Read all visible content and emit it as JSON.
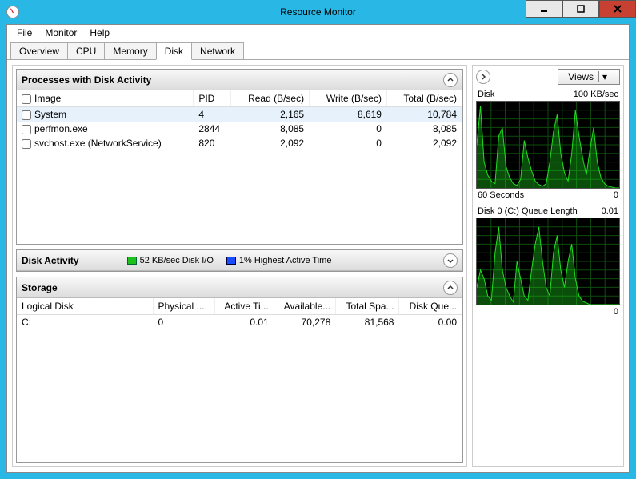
{
  "window": {
    "title": "Resource Monitor"
  },
  "menu": {
    "file": "File",
    "monitor": "Monitor",
    "help": "Help"
  },
  "tabs": {
    "overview": "Overview",
    "cpu": "CPU",
    "memory": "Memory",
    "disk": "Disk",
    "network": "Network",
    "active": "disk"
  },
  "panels": {
    "processes": {
      "title": "Processes with Disk Activity",
      "columns": {
        "image": "Image",
        "pid": "PID",
        "read": "Read (B/sec)",
        "write": "Write (B/sec)",
        "total": "Total (B/sec)"
      },
      "rows": [
        {
          "image": "System",
          "pid": "4",
          "read": "2,165",
          "write": "8,619",
          "total": "10,784",
          "selected": true
        },
        {
          "image": "perfmon.exe",
          "pid": "2844",
          "read": "8,085",
          "write": "0",
          "total": "8,085",
          "selected": false
        },
        {
          "image": "svchost.exe (NetworkService)",
          "pid": "820",
          "read": "2,092",
          "write": "0",
          "total": "2,092",
          "selected": false
        }
      ]
    },
    "diskActivity": {
      "title": "Disk Activity",
      "io_label": "52 KB/sec Disk I/O",
      "active_label": "1% Highest Active Time"
    },
    "storage": {
      "title": "Storage",
      "columns": {
        "logical": "Logical Disk",
        "physical": "Physical ...",
        "active": "Active Ti...",
        "available": "Available...",
        "total": "Total Spa...",
        "queue": "Disk Que..."
      },
      "rows": [
        {
          "logical": "C:",
          "physical": "0",
          "active": "0.01",
          "available": "70,278",
          "total": "81,568",
          "queue": "0.00"
        }
      ]
    }
  },
  "sidebar": {
    "views": "Views",
    "chart1": {
      "title": "Disk",
      "scale": "100 KB/sec",
      "xlabel": "60 Seconds",
      "xright": "0"
    },
    "chart2": {
      "title": "Disk 0 (C:) Queue Length",
      "scale": "0.01",
      "xright": "0"
    }
  },
  "chart_data": [
    {
      "type": "area",
      "title": "Disk",
      "xlabel": "60 Seconds",
      "ylabel": "KB/sec",
      "ylim": [
        0,
        100
      ],
      "x_seconds_range": [
        60,
        0
      ],
      "series": [
        {
          "name": "Disk I/O",
          "values": [
            50,
            95,
            30,
            15,
            8,
            5,
            60,
            70,
            25,
            12,
            5,
            3,
            10,
            55,
            35,
            20,
            8,
            4,
            2,
            5,
            30,
            65,
            85,
            40,
            18,
            8,
            40,
            90,
            60,
            35,
            15,
            45,
            70,
            30,
            12,
            5,
            2,
            1,
            0,
            0
          ]
        }
      ]
    },
    {
      "type": "area",
      "title": "Disk 0 (C:) Queue Length",
      "ylabel": "Queue Length",
      "ylim": [
        0,
        0.01
      ],
      "x_seconds_range": [
        60,
        0
      ],
      "series": [
        {
          "name": "Queue",
          "values": [
            0.002,
            0.004,
            0.003,
            0.001,
            0.0005,
            0.006,
            0.009,
            0.004,
            0.002,
            0.001,
            0.0003,
            0.005,
            0.003,
            0.001,
            0.0005,
            0.004,
            0.007,
            0.009,
            0.005,
            0.002,
            0.001,
            0.006,
            0.008,
            0.004,
            0.002,
            0.005,
            0.007,
            0.003,
            0.001,
            0.0004,
            0.0002,
            0,
            0,
            0,
            0,
            0,
            0,
            0,
            0,
            0
          ]
        }
      ]
    }
  ]
}
